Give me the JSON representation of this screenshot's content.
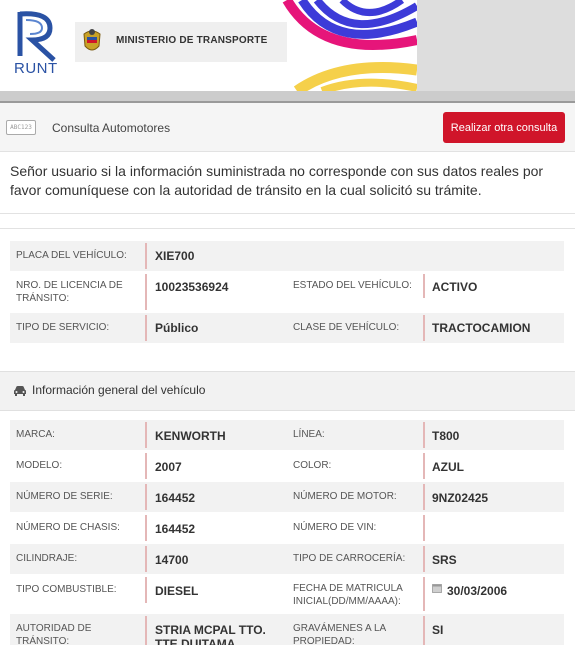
{
  "header": {
    "logo_text": "RUNT",
    "ministry": "MINISTERIO DE TRANSPORTE"
  },
  "toolbar": {
    "plate_icon_text": "ABC123",
    "title": "Consulta Automotores",
    "button_label": "Realizar otra consulta"
  },
  "notice": "Señor usuario si la información suministrada no corresponde con sus datos reales por favor comuníquese con la autoridad de tránsito en la cual solicitó su trámite.",
  "summary": {
    "placa_label": "PLACA DEL VEHÍCULO:",
    "placa": "XIE700",
    "licencia_label": "NRO. DE LICENCIA DE TRÁNSITO:",
    "licencia": "10023536924",
    "estado_label": "ESTADO DEL VEHÍCULO:",
    "estado": "ACTIVO",
    "servicio_label": "TIPO DE SERVICIO:",
    "servicio": "Público",
    "clase_label": "CLASE DE VEHÍCULO:",
    "clase": "TRACTOCAMION"
  },
  "section": {
    "title": "Información general del vehículo",
    "icon": "car-icon"
  },
  "general": {
    "marca_label": "MARCA:",
    "marca": "KENWORTH",
    "linea_label": "LÍNEA:",
    "linea": "T800",
    "modelo_label": "MODELO:",
    "modelo": "2007",
    "color_label": "COLOR:",
    "color": "AZUL",
    "serie_label": "NÚMERO DE SERIE:",
    "serie": "164452",
    "motor_label": "NÚMERO DE MOTOR:",
    "motor": "9NZ02425",
    "chasis_label": "NÚMERO DE CHASIS:",
    "chasis": "164452",
    "vin_label": "NÚMERO DE VIN:",
    "vin": "",
    "cilindraje_label": "CILINDRAJE:",
    "cilindraje": "14700",
    "carroceria_label": "TIPO DE CARROCERÍA:",
    "carroceria": "SRS",
    "combustible_label": "TIPO COMBUSTIBLE:",
    "combustible": "DIESEL",
    "matricula_label": "FECHA DE MATRICULA INICIAL(DD/MM/AAAA):",
    "matricula": "30/03/2006",
    "autoridad_label": "AUTORIDAD DE TRÁNSITO:",
    "autoridad": "STRIA MCPAL TTO. TTE DUITAMA",
    "gravamenes_label": "GRAVÁMENES A LA PROPIEDAD:",
    "gravamenes": "SI"
  },
  "colors": {
    "accent": "#d0152a",
    "runt_blue": "#2a52a4",
    "divider": "#e4b7b7",
    "row_shade": "#f2f2f2"
  }
}
